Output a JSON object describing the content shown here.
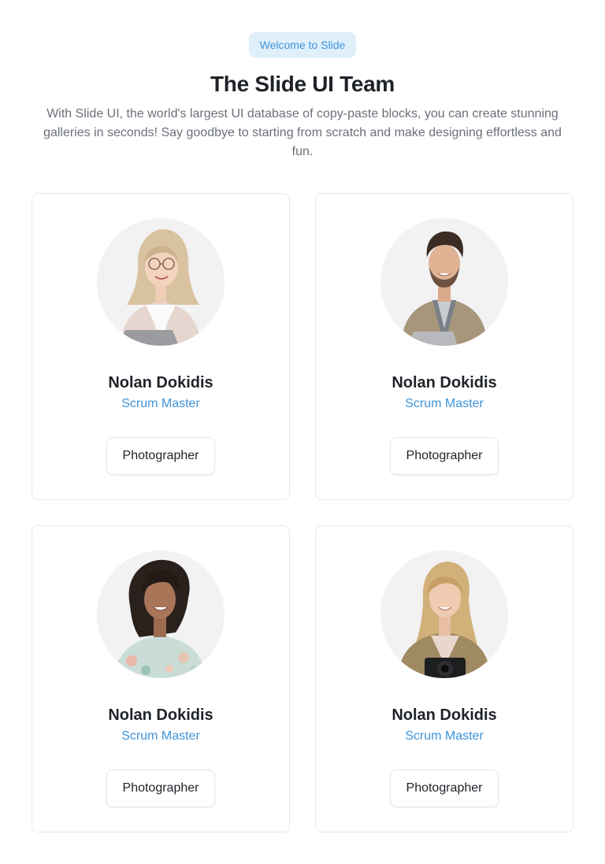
{
  "header": {
    "badge": "Welcome to Slide",
    "title": "The Slide UI Team",
    "subtitle": "With Slide UI, the world's largest UI database of copy-paste blocks, you can create stunning galleries in seconds! Say goodbye to starting from scratch and make designing effortless and fun."
  },
  "team": [
    {
      "name": "Nolan Dokidis",
      "role": "Scrum Master",
      "tag": "Photographer",
      "photo": "woman-glasses-laptop"
    },
    {
      "name": "Nolan Dokidis",
      "role": "Scrum Master",
      "tag": "Photographer",
      "photo": "man-jacket-laptop"
    },
    {
      "name": "Nolan Dokidis",
      "role": "Scrum Master",
      "tag": "Photographer",
      "photo": "woman-curly-hair"
    },
    {
      "name": "Nolan Dokidis",
      "role": "Scrum Master",
      "tag": "Photographer",
      "photo": "woman-camera"
    }
  ],
  "colors": {
    "accent": "#3f93d8",
    "badge_bg": "#dff0fb",
    "text": "#1f2329",
    "muted": "#6b7079",
    "border": "#e6e8eb"
  }
}
